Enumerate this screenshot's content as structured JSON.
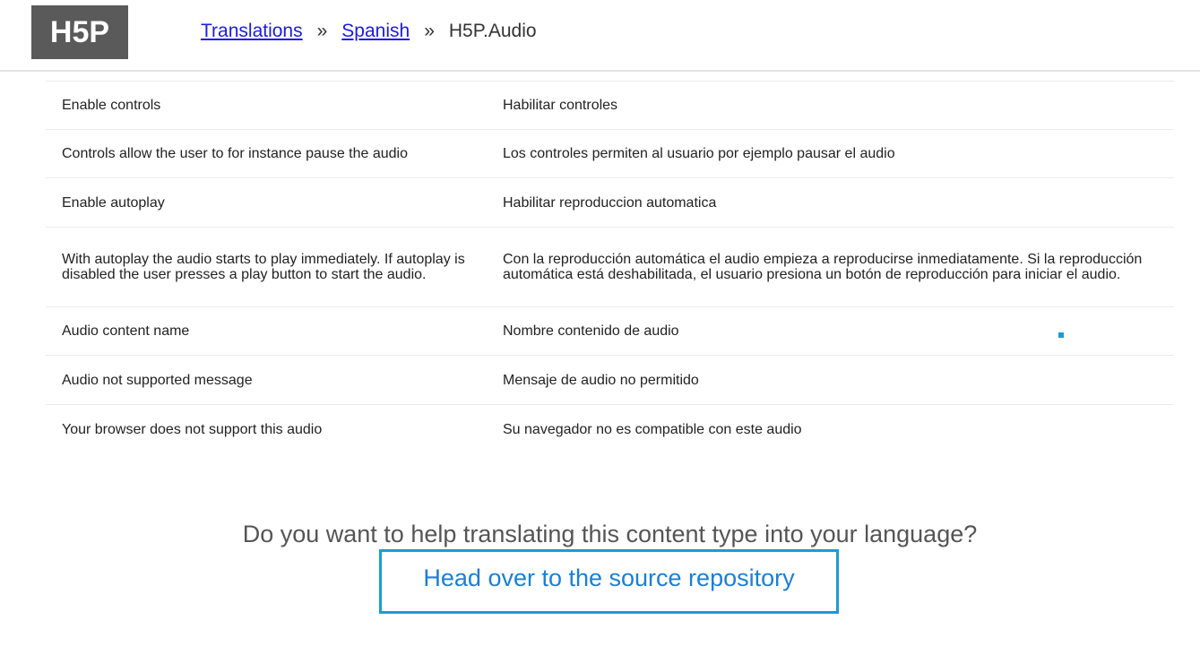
{
  "header": {
    "logo_text": "H5P",
    "breadcrumb": {
      "items": [
        {
          "label": "Translations"
        },
        {
          "label": "Spanish"
        }
      ],
      "separator": "»",
      "current": "H5P.Audio"
    }
  },
  "table": {
    "rows": [
      {
        "source": "Enable controls",
        "translation": "Habilitar controles"
      },
      {
        "source": "Controls allow the user to for instance pause the audio",
        "translation": "Los controles permiten al usuario por ejemplo pausar el audio"
      },
      {
        "source": "Enable autoplay",
        "translation": "Habilitar reproduccion automatica"
      },
      {
        "source": "With autoplay the audio starts to play immediately. If autoplay is disabled the user presses a play button to start the audio.",
        "translation": "Con la reproducción automática el audio empieza a reproducirse inmediatamente. Si la reproducción automática está deshabilitada, el usuario presiona un botón de reproducción para iniciar el audio."
      },
      {
        "source": "Audio content name",
        "translation": "Nombre contenido de audio"
      },
      {
        "source": "Audio not supported message",
        "translation": "Mensaje de audio no permitido"
      },
      {
        "source": "Your browser does not support this audio",
        "translation": "Su navegador no es compatible con este audio"
      }
    ]
  },
  "cta": {
    "question": "Do you want to help translating this content type into your language?",
    "link_label": "Head over to the source repository"
  },
  "colors": {
    "accent": "#1a9cd6",
    "link": "#1a1ae6",
    "logo_bg": "#5a5a5a"
  }
}
